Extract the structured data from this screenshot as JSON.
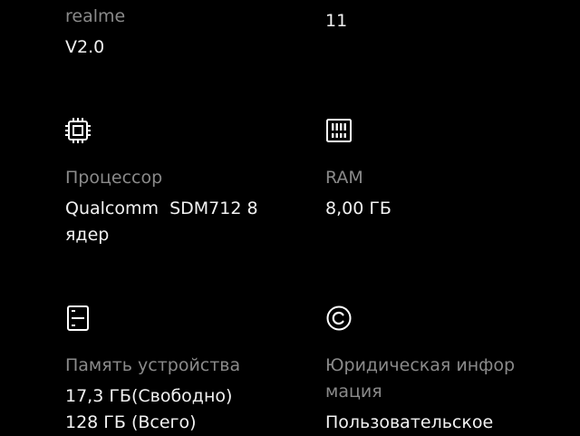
{
  "colors": {
    "background": "#000000",
    "label": "#8a8a8a",
    "value": "#f2f2f2",
    "icon": "#ffffff"
  },
  "top_left": {
    "label": "realme",
    "value": "V2.0"
  },
  "top_right": {
    "value": "11"
  },
  "processor": {
    "icon": "chip-icon",
    "label": "Процессор",
    "value": "Qualcomm  SDM712 8\nядер"
  },
  "ram": {
    "icon": "ram-icon",
    "label": "RAM",
    "value": "8,00 ГБ"
  },
  "storage": {
    "icon": "storage-icon",
    "label": "Память устройства",
    "value": "17,3 ГБ(Свободно)\n128 ГБ (Всего)"
  },
  "legal": {
    "icon": "copyright-icon",
    "label": "Юридическая инфор\nмация",
    "value": "Пользовательское"
  }
}
